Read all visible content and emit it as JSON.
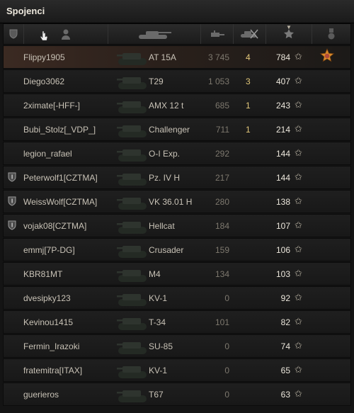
{
  "panel": {
    "title": "Spojenci"
  },
  "columns": {
    "platoon": "shield-icon",
    "player": "person-icon",
    "vehicle": "tank-icon",
    "damage": "gun-icon",
    "kills": "destroyed-tank-icon",
    "xp": "star-icon",
    "medal": "medal-icon"
  },
  "colors": {
    "self_row": "#3b2a22",
    "kills": "#e2c77a",
    "medal": "#d98a2a"
  },
  "rows": [
    {
      "name": "Flippy1905",
      "vehicle": "AT 15A",
      "damage": "3 745",
      "kills": "4",
      "xp": "784",
      "platoon": false,
      "self": true,
      "medal": true
    },
    {
      "name": "Diego3062",
      "vehicle": "T29",
      "damage": "1 053",
      "kills": "3",
      "xp": "407",
      "platoon": false
    },
    {
      "name": "2ximate[-HFF-]",
      "vehicle": "AMX 12 t",
      "damage": "685",
      "kills": "1",
      "xp": "243",
      "platoon": false
    },
    {
      "name": "Bubi_Stolz[_VDP_]",
      "vehicle": "Challenger",
      "damage": "711",
      "kills": "1",
      "xp": "214",
      "platoon": false
    },
    {
      "name": "legion_rafael",
      "vehicle": "O-I Exp.",
      "damage": "292",
      "kills": "",
      "xp": "144",
      "platoon": false
    },
    {
      "name": "Peterwolf1[CZTMA]",
      "vehicle": "Pz. IV H",
      "damage": "217",
      "kills": "",
      "xp": "144",
      "platoon": true
    },
    {
      "name": "WeissWolf[CZTMA]",
      "vehicle": "VK 36.01 H",
      "damage": "280",
      "kills": "",
      "xp": "138",
      "platoon": true
    },
    {
      "name": "vojak08[CZTMA]",
      "vehicle": "Hellcat",
      "damage": "184",
      "kills": "",
      "xp": "107",
      "platoon": true
    },
    {
      "name": "emmj[7P-DG]",
      "vehicle": "Crusader",
      "damage": "159",
      "kills": "",
      "xp": "106",
      "platoon": false
    },
    {
      "name": "KBR81MT",
      "vehicle": "M4",
      "damage": "134",
      "kills": "",
      "xp": "103",
      "platoon": false
    },
    {
      "name": "dvesipky123",
      "vehicle": "KV-1",
      "damage": "0",
      "kills": "",
      "xp": "92",
      "platoon": false
    },
    {
      "name": "Kevinou1415",
      "vehicle": "T-34",
      "damage": "101",
      "kills": "",
      "xp": "82",
      "platoon": false
    },
    {
      "name": "Fermin_Irazoki",
      "vehicle": "SU-85",
      "damage": "0",
      "kills": "",
      "xp": "74",
      "platoon": false
    },
    {
      "name": "fratemitra[ITAX]",
      "vehicle": "KV-1",
      "damage": "0",
      "kills": "",
      "xp": "65",
      "platoon": false
    },
    {
      "name": "guerieros",
      "vehicle": "T67",
      "damage": "0",
      "kills": "",
      "xp": "63",
      "platoon": false
    }
  ]
}
